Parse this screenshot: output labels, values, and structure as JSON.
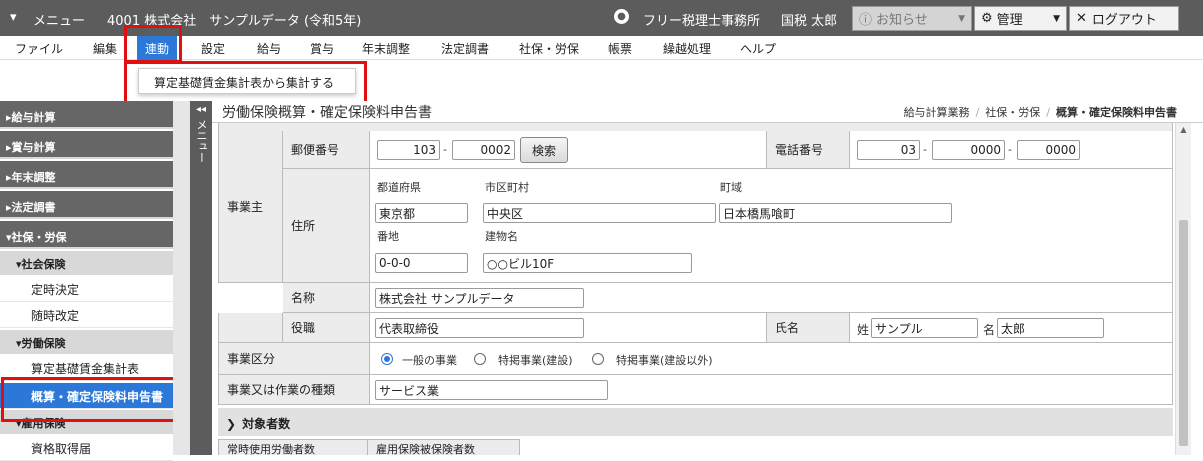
{
  "topbar": {
    "menu_label": "メニュー",
    "company": "4001 株式会社　サンプルデータ (令和5年)",
    "office": "フリー税理士事務所",
    "user": "国税 太郎",
    "notice_label": "お知らせ",
    "admin_label": "管理",
    "logout_label": "ログアウト"
  },
  "menubar": {
    "items": [
      "ファイル",
      "編集",
      "連動",
      "設定",
      "給与",
      "賞与",
      "年末調整",
      "法定調書",
      "社保・労保",
      "帳票",
      "繰越処理",
      "ヘルプ"
    ],
    "active": "連動",
    "dropdown_item": "算定基礎賃金集計表から集計する"
  },
  "sidebar": {
    "sections": [
      "給与計算",
      "賞与計算",
      "年末調整",
      "法定調書",
      "社保・労保"
    ],
    "group_social": "社会保険",
    "social_items": [
      "定時決定",
      "随時改定"
    ],
    "group_labor": "労働保険",
    "labor_items": [
      "算定基礎賃金集計表",
      "概算・確定保険料申告書"
    ],
    "group_employment": "雇用保険",
    "employment_items": [
      "資格取得届"
    ],
    "menu_tab": "メニュー"
  },
  "page": {
    "title": "労働保険概算・確定保険料申告書",
    "breadcrumb": [
      "給与計算業務",
      "社保・労保",
      "概算・確定保険料申告書"
    ]
  },
  "form": {
    "employer_label": "事業主",
    "postal_label": "郵便番号",
    "postal1": "103",
    "postal2": "0002",
    "search_button": "検索",
    "phone_label": "電話番号",
    "phone1": "03",
    "phone2": "0000",
    "phone3": "0000",
    "address_label": "住所",
    "pref_caption": "都道府県",
    "pref_value": "東京都",
    "city_caption": "市区町村",
    "city_value": "中央区",
    "town_caption": "町域",
    "town_value": "日本橋馬喰町",
    "banchi_caption": "番地",
    "banchi_value": "0-0-0",
    "building_caption": "建物名",
    "building_value": "○○ビル10F",
    "name_label": "名称",
    "name_value": "株式会社 サンプルデータ",
    "position_label": "役職",
    "position_value": "代表取締役",
    "person_label": "氏名",
    "sei_label": "姓",
    "sei_value": "サンプル",
    "mei_label": "名",
    "mei_value": "太郎",
    "business_type_label": "事業区分",
    "business_options": [
      "一般の事業",
      "特掲事業(建設)",
      "特掲事業(建設以外)"
    ],
    "business_selected": "一般の事業",
    "work_type_label": "事業又は作業の種類",
    "work_type_value": "サービス業",
    "section_title": "対象者数",
    "col_regular": "常時使用労働者数",
    "col_employment": "雇用保険被保険者数"
  }
}
